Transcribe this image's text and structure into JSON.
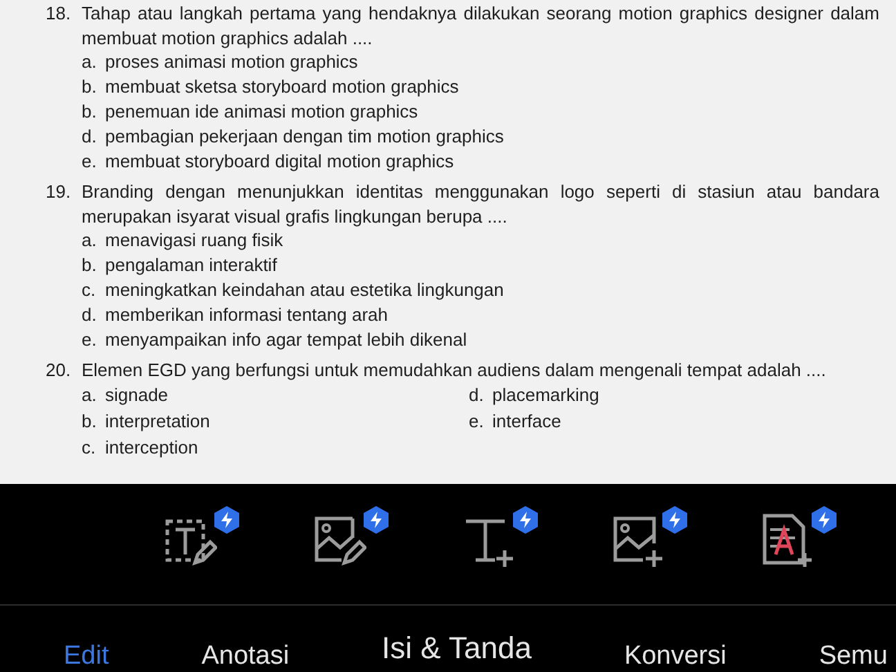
{
  "questions": [
    {
      "number": "18.",
      "text": "Tahap atau langkah pertama yang hendaknya dilakukan seorang motion graphics designer dalam membuat motion graphics adalah ....",
      "kind": "list",
      "options": [
        {
          "letter": "a.",
          "text": "proses animasi motion graphics"
        },
        {
          "letter": "b.",
          "text": "membuat sketsa storyboard motion graphics"
        },
        {
          "letter": "b.",
          "text": "penemuan ide animasi motion graphics"
        },
        {
          "letter": "d.",
          "text": "pembagian pekerjaan dengan tim motion graphics"
        },
        {
          "letter": "e.",
          "text": "membuat storyboard digital motion graphics"
        }
      ]
    },
    {
      "number": "19.",
      "text": "Branding dengan menunjukkan identitas menggunakan logo seperti di stasiun atau bandara merupakan isyarat visual grafis lingkungan berupa ....",
      "kind": "list",
      "options": [
        {
          "letter": "a.",
          "text": "menavigasi ruang fisik"
        },
        {
          "letter": "b.",
          "text": "pengalaman interaktif"
        },
        {
          "letter": "c.",
          "text": "meningkatkan keindahan atau estetika lingkungan"
        },
        {
          "letter": "d.",
          "text": "memberikan informasi tentang arah"
        },
        {
          "letter": "e.",
          "text": "menyampaikan info agar tempat lebih dikenal"
        }
      ]
    },
    {
      "number": "20.",
      "text": "Elemen EGD yang berfungsi untuk memudahkan audiens dalam mengenali tempat adalah ....",
      "kind": "two-column",
      "options": [
        {
          "letter": "a.",
          "text": "signade"
        },
        {
          "letter": "b.",
          "text": "interpretation"
        },
        {
          "letter": "c.",
          "text": "interception"
        },
        {
          "letter": "d.",
          "text": "placemarking"
        },
        {
          "letter": "e.",
          "text": "interface"
        }
      ]
    }
  ],
  "tools": [
    {
      "kind": "edit-text",
      "premium": true
    },
    {
      "kind": "edit-image",
      "premium": true
    },
    {
      "kind": "add-text",
      "premium": true
    },
    {
      "kind": "add-image",
      "premium": true
    },
    {
      "kind": "add-signature",
      "premium": true
    }
  ],
  "tabs": [
    {
      "label": "Edit",
      "selected": true,
      "focused": false
    },
    {
      "label": "Anotasi",
      "selected": false,
      "focused": false
    },
    {
      "label": "Isi & Tanda",
      "selected": false,
      "focused": true
    },
    {
      "label": "Konversi",
      "selected": false,
      "focused": false
    },
    {
      "label": "Semu",
      "selected": false,
      "focused": false
    }
  ]
}
